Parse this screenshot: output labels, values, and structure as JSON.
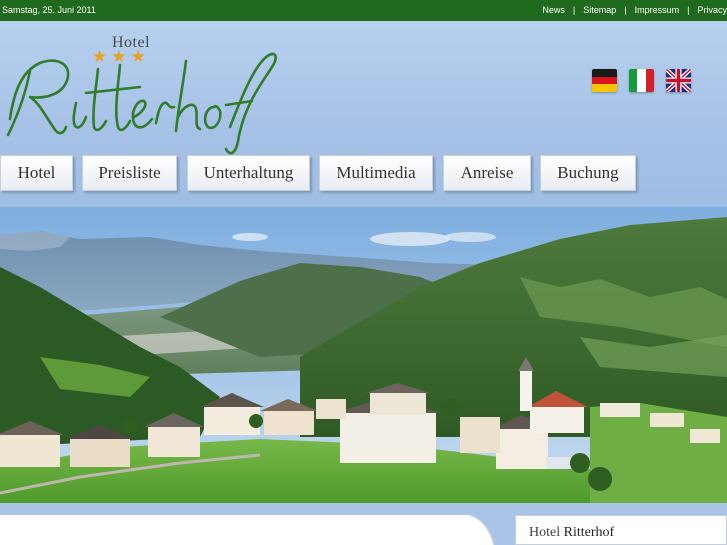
{
  "topbar": {
    "date": "Samstag, 25. Juni 2011",
    "links": [
      "News",
      "Sitemap",
      "Impressum",
      "Privacy"
    ],
    "separator": "|"
  },
  "logo": {
    "hotel_word": "Hotel",
    "stars": "★★★",
    "name": "Ritterhof"
  },
  "flags": [
    {
      "name": "german-flag-icon",
      "lang": "de"
    },
    {
      "name": "italian-flag-icon",
      "lang": "it"
    },
    {
      "name": "english-flag-icon",
      "lang": "en"
    }
  ],
  "nav": [
    "Hotel",
    "Preisliste",
    "Unterhaltung",
    "Multimedia",
    "Anreise",
    "Buchung"
  ],
  "sidebar": {
    "title_prefix": "Hotel",
    "title_name": "Ritterhof"
  },
  "colors": {
    "topbar_bg": "#1f6a1f",
    "header_bg": "#a9c4e6",
    "logo_green": "#2f7d2a",
    "star_gold": "#e9a21a"
  }
}
